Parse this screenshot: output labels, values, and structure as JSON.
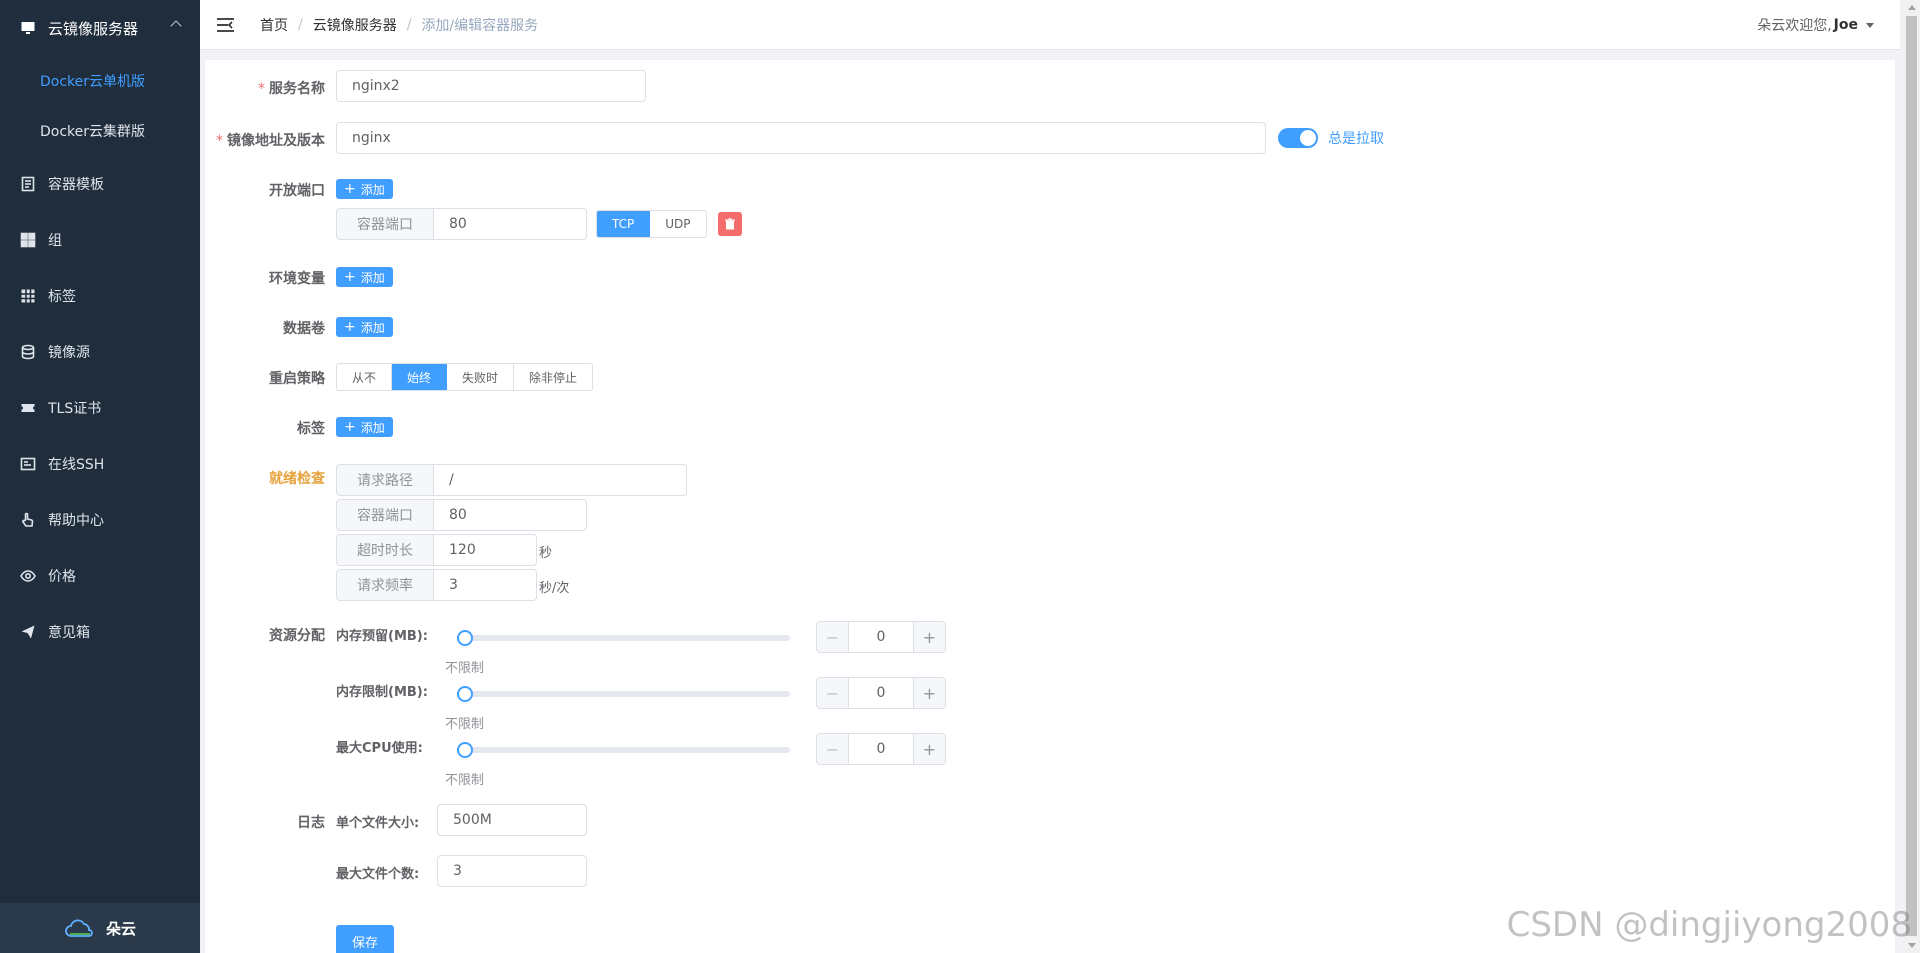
{
  "sidebar": {
    "group_title": "云镜像服务器",
    "sub_items": [
      "Docker云单机版",
      "Docker云集群版"
    ],
    "items": [
      "容器模板",
      "组",
      "标签",
      "镜像源",
      "TLS证书",
      "在线SSH",
      "帮助中心",
      "价格",
      "意见箱"
    ],
    "footer_brand": "朵云"
  },
  "header": {
    "breadcrumb": [
      "首页",
      "云镜像服务器",
      "添加/编辑容器服务"
    ],
    "welcome": "朵云欢迎您,",
    "username": "Joe"
  },
  "form": {
    "service_name_label": "服务名称",
    "service_name_value": "nginx2",
    "image_label": "镜像地址及版本",
    "image_value": "nginx",
    "always_pull_label": "总是拉取",
    "ports_label": "开放端口",
    "add_label": "添加",
    "container_port_label": "容器端口",
    "container_port_value": "80",
    "protocol_options": [
      "TCP",
      "UDP"
    ],
    "env_label": "环境变量",
    "volume_label": "数据卷",
    "restart_label": "重启策略",
    "restart_options": [
      "从不",
      "始终",
      "失败时",
      "除非停止"
    ],
    "tags_label": "标签",
    "readiness_label": "就绪检查",
    "readiness": {
      "path_label": "请求路径",
      "path_value": "/",
      "port_label": "容器端口",
      "port_value": "80",
      "timeout_label": "超时时长",
      "timeout_value": "120",
      "timeout_unit": "秒",
      "freq_label": "请求频率",
      "freq_value": "3",
      "freq_unit": "秒/次"
    },
    "resource_label": "资源分配",
    "resources": [
      {
        "label": "内存预留(MB):",
        "value": "0",
        "hint": "不限制"
      },
      {
        "label": "内存限制(MB):",
        "value": "0",
        "hint": "不限制"
      },
      {
        "label": "最大CPU使用:",
        "value": "0",
        "hint": "不限制"
      }
    ],
    "log_label": "日志",
    "log_file_size_label": "单个文件大小:",
    "log_file_size_value": "500M",
    "log_max_files_label": "最大文件个数:",
    "log_max_files_value": "3",
    "save_label": "保存"
  },
  "watermark": "CSDN @dingjiyong2008",
  "colors": {
    "primary": "#409eff",
    "danger": "#f56c6c",
    "warning": "#e6a23c",
    "sidebar": "#1f2d3d"
  }
}
